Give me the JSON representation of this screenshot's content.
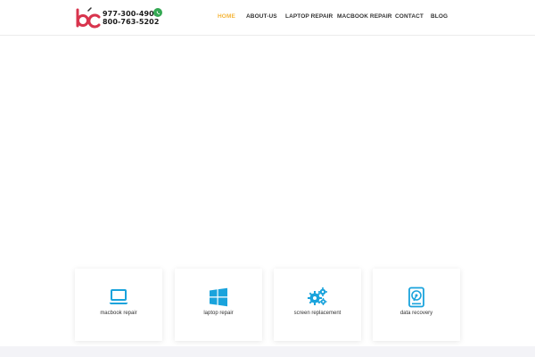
{
  "header": {
    "phone_primary": "977-300-4903",
    "phone_secondary": "800-763-5202",
    "logo_icon": "bc-logo-icon",
    "whatsapp_icon": "whatsapp-icon"
  },
  "nav": {
    "items": [
      {
        "label": "HOME",
        "active": true
      },
      {
        "label": "ABOUT-US",
        "active": false
      },
      {
        "label": "LAPTOP REPAIR",
        "active": false
      },
      {
        "label": "MACBOOK REPAIR",
        "active": false
      },
      {
        "label": "CONTACT",
        "active": false
      },
      {
        "label": "BLOG",
        "active": false
      }
    ]
  },
  "services": [
    {
      "label": "macbook repair",
      "icon": "laptop-icon"
    },
    {
      "label": "laptop repair",
      "icon": "windows-icon"
    },
    {
      "label": "screen replacement",
      "icon": "gears-icon"
    },
    {
      "label": "data recovery",
      "icon": "hard-drive-icon"
    }
  ],
  "colors": {
    "accent": "#f5b63b",
    "icon_blue": "#1aa3dc",
    "logo_red": "#d8344d",
    "whatsapp_green": "#34a853",
    "text": "#333333"
  }
}
